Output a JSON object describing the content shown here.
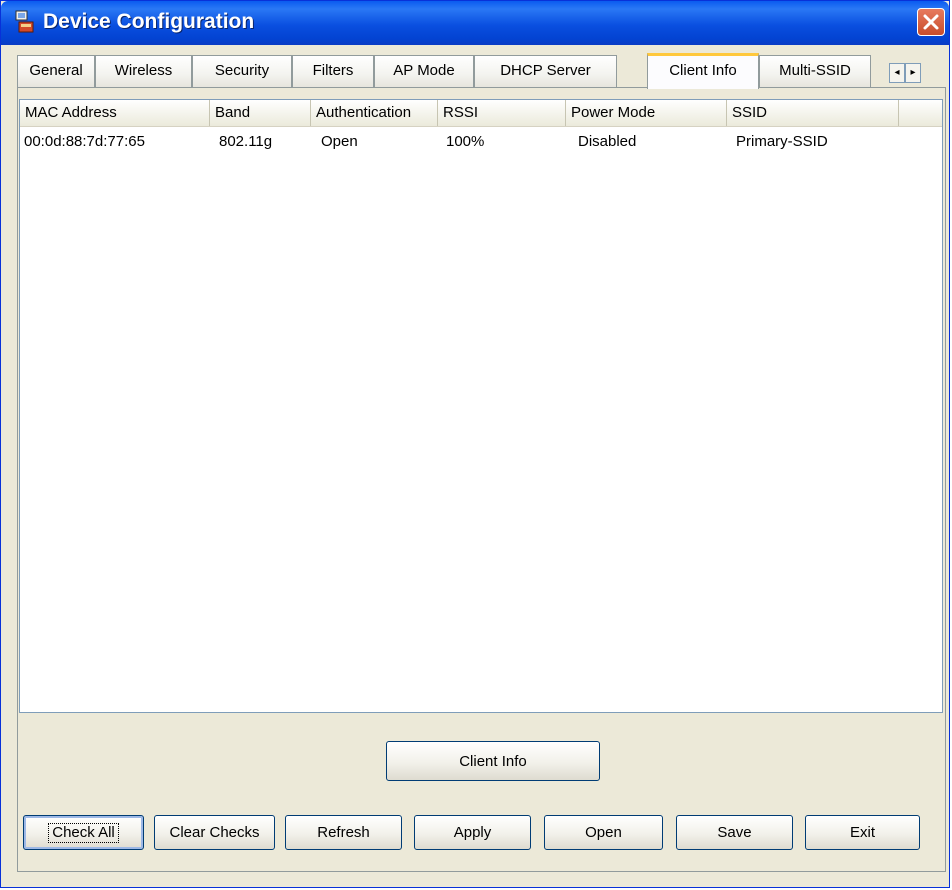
{
  "window": {
    "title": "Device Configuration"
  },
  "tabs": [
    {
      "label": "General"
    },
    {
      "label": "Wireless"
    },
    {
      "label": "Security"
    },
    {
      "label": "Filters"
    },
    {
      "label": "AP Mode"
    },
    {
      "label": "DHCP Server"
    },
    {
      "label": "Client Info",
      "active": true
    },
    {
      "label": "Multi-SSID"
    }
  ],
  "tab_scroll": {
    "left": "◂",
    "right": "▸"
  },
  "client_list": {
    "columns": [
      "MAC Address",
      "Band",
      "Authentication",
      "RSSI",
      "Power Mode",
      "SSID"
    ],
    "rows": [
      [
        "00:0d:88:7d:77:65",
        "802.11g",
        "Open",
        "100%",
        "Disabled",
        "Primary-SSID"
      ]
    ]
  },
  "client_info_button": "Client Info",
  "buttons": {
    "check_all": "Check All",
    "clear_checks": "Clear Checks",
    "refresh": "Refresh",
    "apply": "Apply",
    "open": "Open",
    "save": "Save",
    "exit": "Exit"
  },
  "icons": {
    "app": "device-config-icon",
    "close": "close-icon"
  },
  "colors": {
    "titlebar": "#0a4fe0",
    "close": "#d8583a",
    "face": "#ece9d8",
    "active_tab_accent": "#ffc83c"
  }
}
